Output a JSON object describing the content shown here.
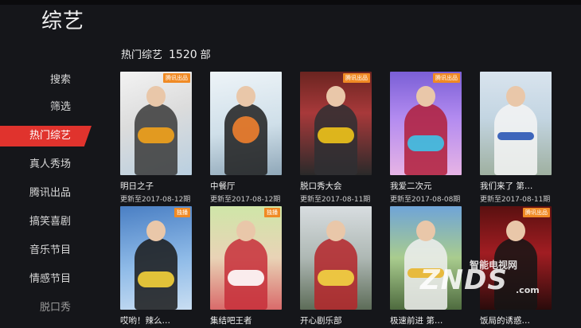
{
  "page_title": "综艺",
  "section": {
    "title": "热门综艺",
    "count": "1520",
    "unit": "部"
  },
  "sidebar": {
    "items": [
      {
        "label": "搜索"
      },
      {
        "label": "筛选"
      },
      {
        "label": "热门综艺"
      },
      {
        "label": "真人秀场"
      },
      {
        "label": "腾讯出品"
      },
      {
        "label": "搞笑喜剧"
      },
      {
        "label": "音乐节目"
      },
      {
        "label": "情感节目"
      },
      {
        "label": "脱口秀"
      }
    ]
  },
  "cards": [
    {
      "title": "明日之子",
      "update": "更新至2017-08-12期",
      "badge": "腾讯出品"
    },
    {
      "title": "中餐厅",
      "update": "更新至2017-08-12期",
      "badge": ""
    },
    {
      "title": "脱口秀大会",
      "update": "更新至2017-08-11期",
      "badge": "腾讯出品"
    },
    {
      "title": "我爱二次元",
      "update": "更新至2017-08-08期",
      "badge": "腾讯出品"
    },
    {
      "title": "我们来了 第…",
      "update": "更新至2017-08-11期",
      "badge": ""
    },
    {
      "title": "哎哟！辣么…",
      "update": "",
      "badge": "独播"
    },
    {
      "title": "集结吧王者",
      "update": "",
      "badge": "独播"
    },
    {
      "title": "开心剧乐部",
      "update": "",
      "badge": ""
    },
    {
      "title": "极速前进 第…",
      "update": "",
      "badge": ""
    },
    {
      "title": "饭局的诱惑…",
      "update": "",
      "badge": "腾讯出品"
    }
  ],
  "watermark": {
    "top": "智能电视网",
    "main": "ZNDS",
    "suffix": ".com"
  },
  "colors": {
    "accent": "#e0332d",
    "background": "#15161a"
  }
}
